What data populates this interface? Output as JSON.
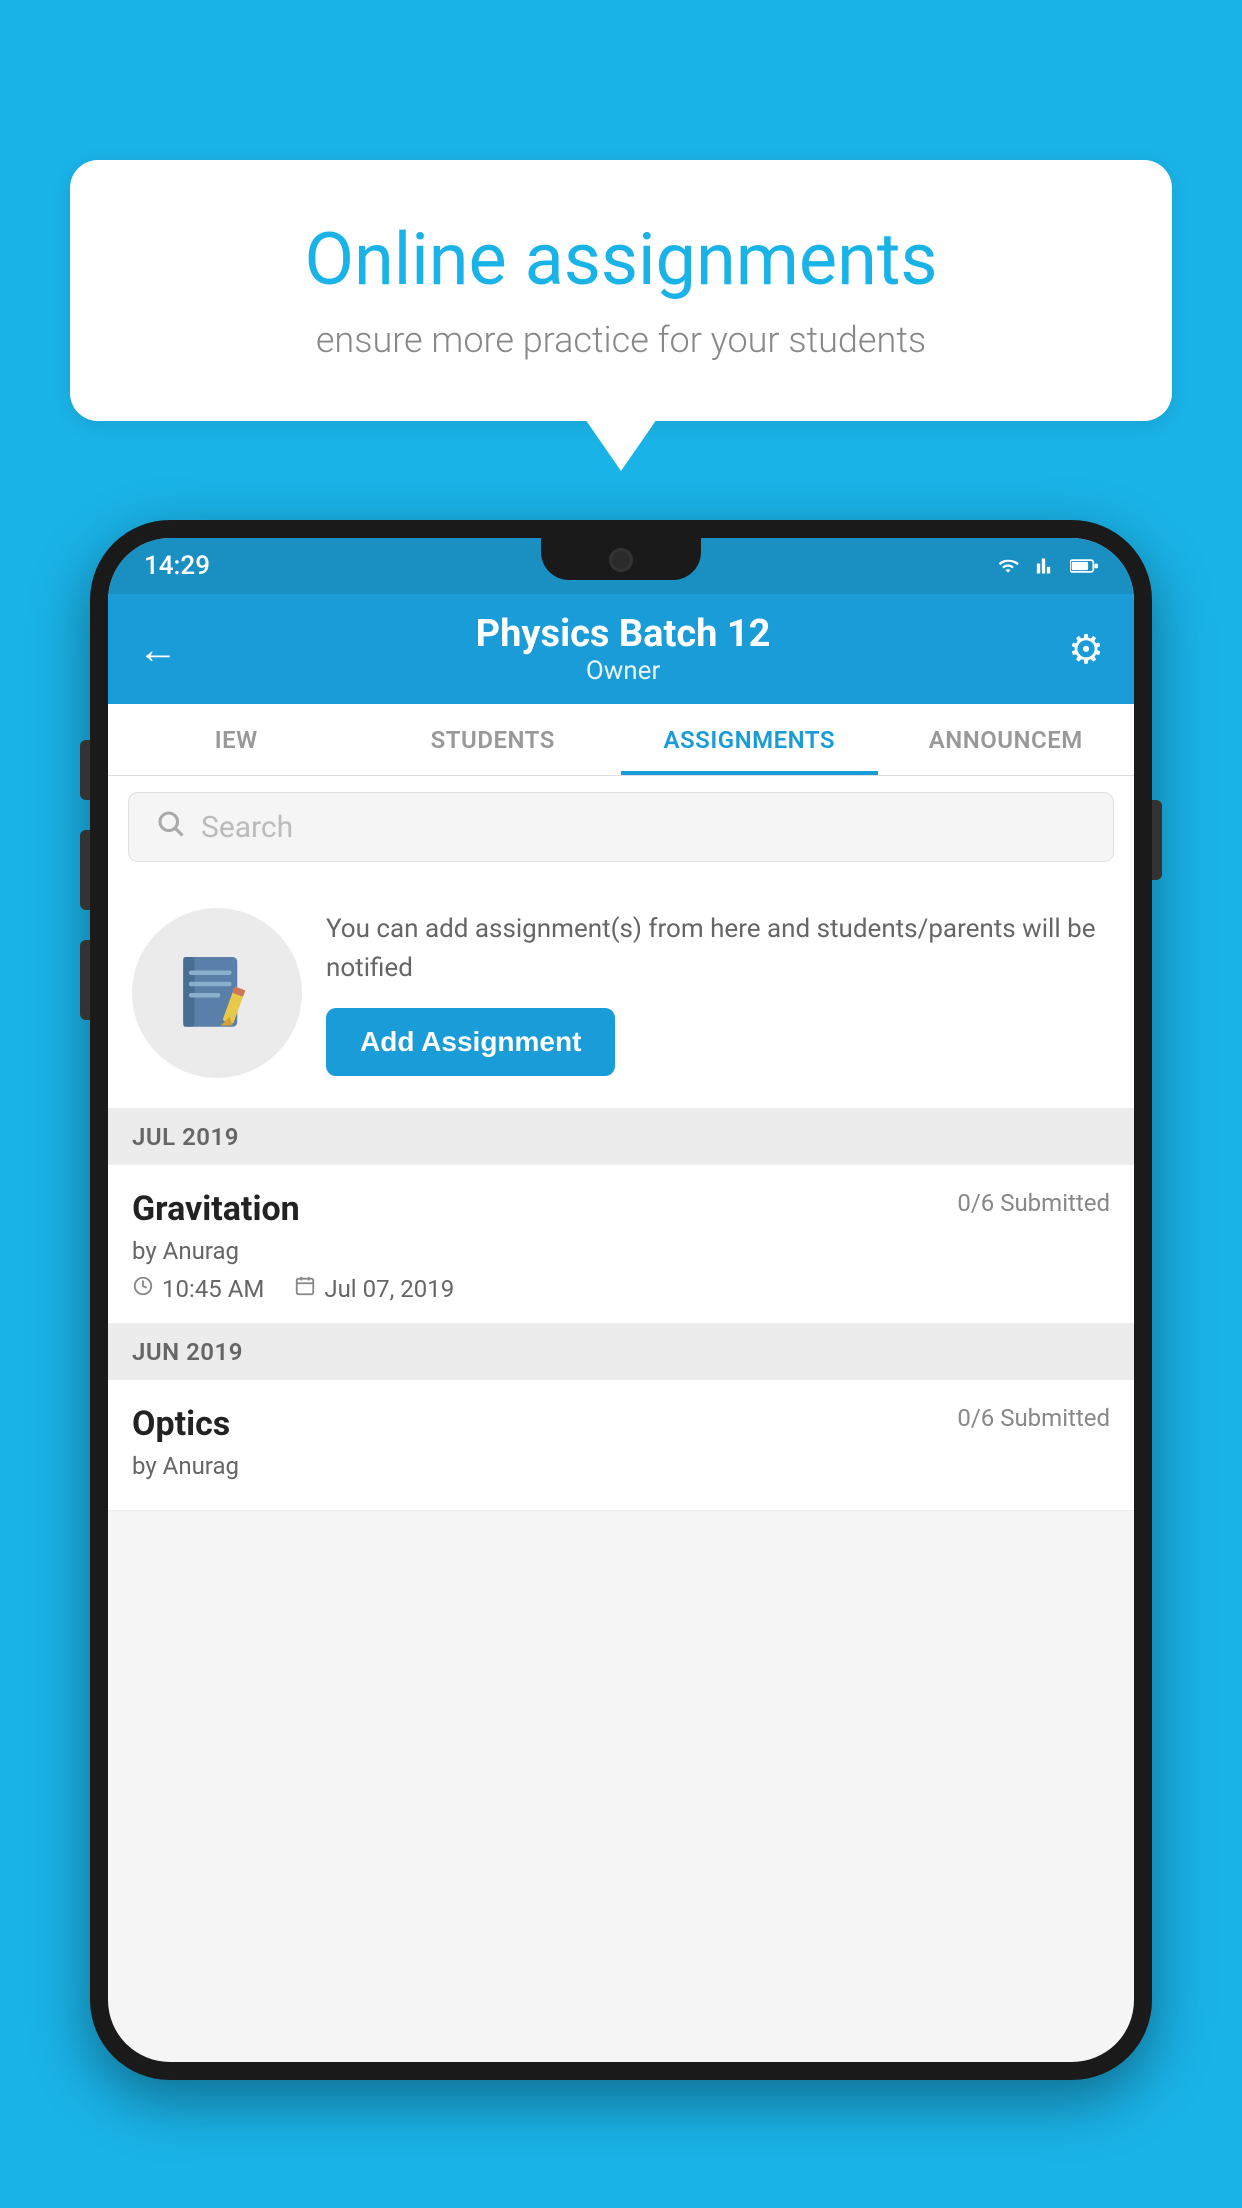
{
  "background_color": "#1ab3e8",
  "speech_bubble": {
    "title": "Online assignments",
    "subtitle": "ensure more practice for your students"
  },
  "phone": {
    "status_bar": {
      "time": "14:29"
    },
    "header": {
      "title": "Physics Batch 12",
      "subtitle": "Owner",
      "back_label": "←",
      "settings_label": "⚙"
    },
    "tabs": [
      {
        "label": "IEW",
        "active": false
      },
      {
        "label": "STUDENTS",
        "active": false
      },
      {
        "label": "ASSIGNMENTS",
        "active": true
      },
      {
        "label": "ANNOUNCEM",
        "active": false
      }
    ],
    "search": {
      "placeholder": "Search"
    },
    "promo": {
      "text": "You can add assignment(s) from here and students/parents will be notified",
      "button_label": "Add Assignment"
    },
    "sections": [
      {
        "header": "JUL 2019",
        "assignments": [
          {
            "name": "Gravitation",
            "submitted": "0/6 Submitted",
            "by": "by Anurag",
            "time": "10:45 AM",
            "date": "Jul 07, 2019"
          }
        ]
      },
      {
        "header": "JUN 2019",
        "assignments": [
          {
            "name": "Optics",
            "submitted": "0/6 Submitted",
            "by": "by Anurag",
            "time": "",
            "date": ""
          }
        ]
      }
    ]
  }
}
